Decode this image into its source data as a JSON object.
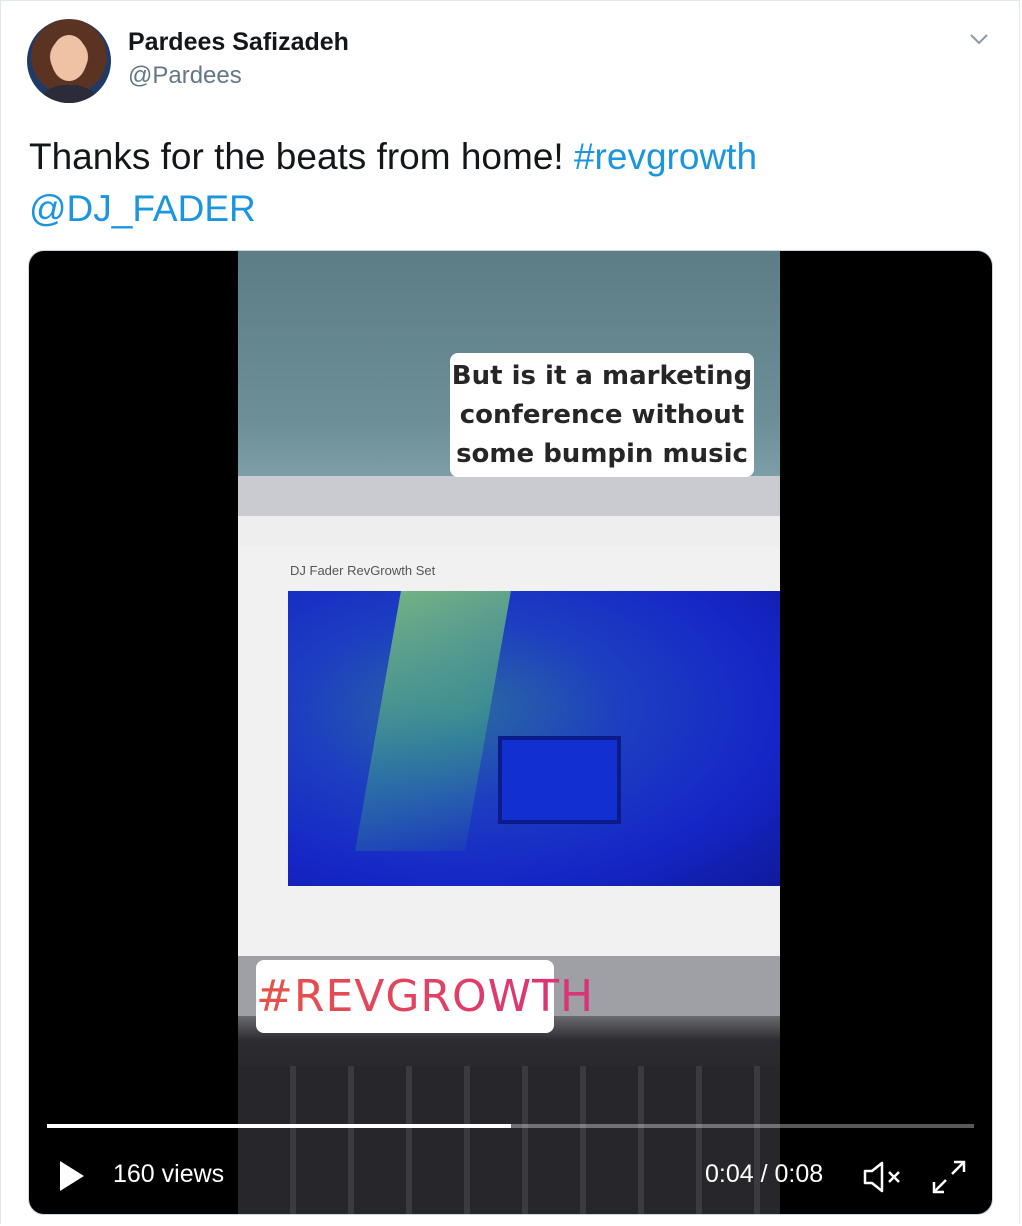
{
  "author": {
    "name": "Pardees Safizadeh",
    "handle": "@Pardees"
  },
  "tweet": {
    "text": "Thanks for the beats from home! ",
    "hashtag": "#revgrowth",
    "mention": "@DJ_FADER"
  },
  "video": {
    "sticker_top_lines": [
      "But is it a marketing",
      "conference without",
      "some bumpin music"
    ],
    "sticker_bottom": "#REVGROWTH",
    "screen_page_title": "DJ Fader RevGrowth Set",
    "views": "160 views",
    "time": "0:04 / 0:08",
    "progress": 0.5,
    "muted": true
  },
  "icons": {
    "menu": "chevron-down-icon",
    "play": "play-icon",
    "mute": "speaker-muted-icon",
    "fullscreen": "fullscreen-icon"
  },
  "colors": {
    "link": "#1b95e0",
    "handle": "#657786",
    "hashtag_sticker": "#e1306c"
  }
}
